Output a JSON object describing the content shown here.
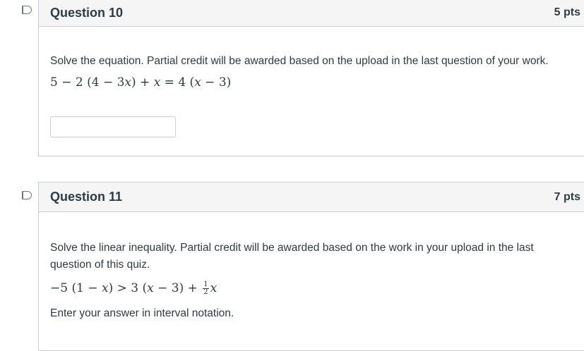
{
  "questions": [
    {
      "title": "Question 10",
      "points": "5 pts",
      "prompt": "Solve the equation. Partial credit will be awarded based on the upload in the last question of your work.",
      "equation": {
        "parts": [
          "5 − 2 (4 − 3",
          "x",
          ") + ",
          "x",
          " = 4 (",
          "x",
          " − 3)"
        ]
      },
      "answer_value": ""
    },
    {
      "title": "Question 11",
      "points": "7 pts",
      "prompt_line1": "Solve the linear inequality. Partial credit will be awarded based on the work in your upload in the last",
      "prompt_line2": "question of this quiz.",
      "inequality": {
        "left": "−5 (1 − ",
        "x1": "x",
        "mid": ") > 3 (",
        "x2": "x",
        "mid2": " − 3) + ",
        "frac_num": "1",
        "frac_den": "2",
        "x3": "x"
      },
      "instruction": "Enter your answer in interval notation."
    }
  ]
}
